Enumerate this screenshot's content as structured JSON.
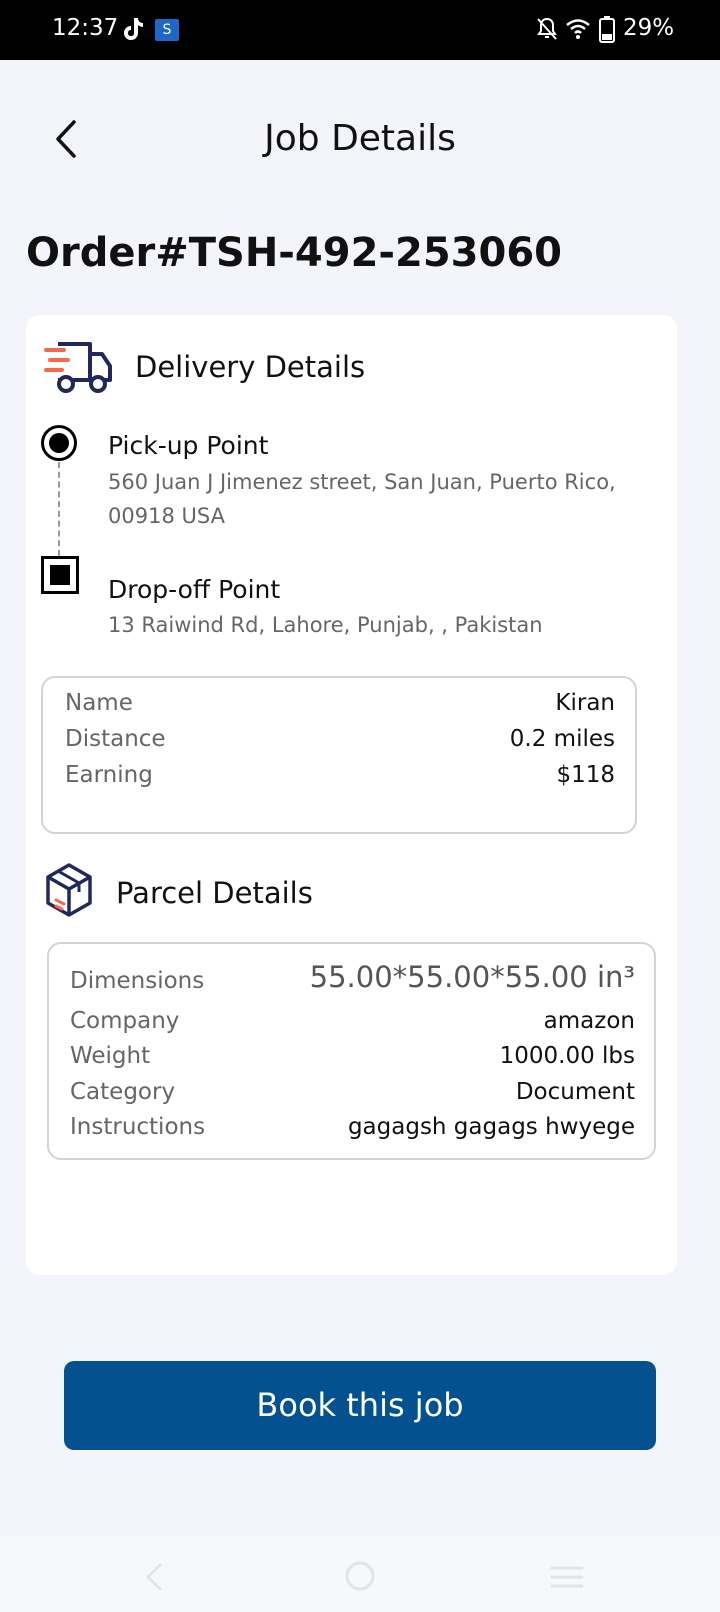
{
  "status_bar": {
    "time": "12:37",
    "battery": "29%",
    "app_badge": "S"
  },
  "header": {
    "title": "Job Details"
  },
  "order": {
    "number": "Order#TSH-492-253060"
  },
  "delivery": {
    "title": "Delivery Details",
    "pickup": {
      "label": "Pick-up Point",
      "address": "560 Juan J Jimenez street, San Juan, Puerto Rico, 00918 USA"
    },
    "dropoff": {
      "label": "Drop-off Point",
      "address": "13 Raiwind Rd, Lahore, Punjab, , Pakistan"
    },
    "info": [
      {
        "label": "Name",
        "value": "Kiran"
      },
      {
        "label": "Distance",
        "value": "0.2 miles"
      },
      {
        "label": "Earning",
        "value": "$118"
      }
    ]
  },
  "parcel": {
    "title": "Parcel Details",
    "rows": [
      {
        "label": "Dimensions",
        "value": "55.00*55.00*55.00 in³"
      },
      {
        "label": "Company",
        "value": "amazon"
      },
      {
        "label": "Weight",
        "value": "1000.00 lbs"
      },
      {
        "label": "Category",
        "value": "Document"
      },
      {
        "label": "Instructions",
        "value": "gagagsh gagags hwyege"
      }
    ]
  },
  "actions": {
    "book_label": "Book this job"
  },
  "colors": {
    "primary": "#03528f",
    "accent": "#f26b4f",
    "icon_navy": "#22285a",
    "background": "#f3f5fb"
  },
  "icons": [
    "back-arrow-icon",
    "truck-icon",
    "parcel-box-icon",
    "tiktok-icon",
    "bell-off-icon",
    "wifi-icon",
    "battery-icon"
  ]
}
